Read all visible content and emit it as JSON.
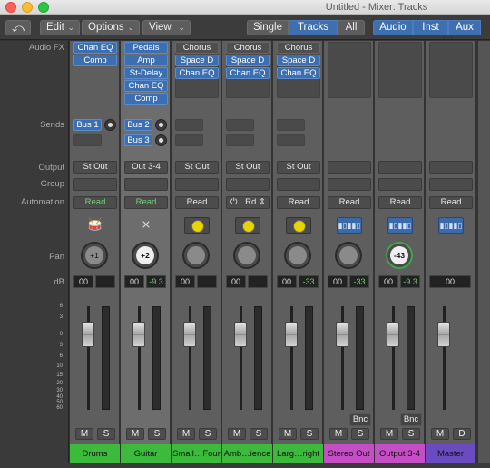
{
  "window": {
    "title": "Untitled - Mixer: Tracks"
  },
  "toolbar": {
    "edit_label": "Edit",
    "options_label": "Options",
    "view_label": "View",
    "single_label": "Single",
    "tracks_label": "Tracks",
    "all_label": "All",
    "audio_label": "Audio",
    "inst_label": "Inst",
    "aux_label": "Aux"
  },
  "row_labels": {
    "audio_fx": "Audio FX",
    "sends": "Sends",
    "output": "Output",
    "group": "Group",
    "automation": "Automation",
    "pan": "Pan",
    "db": "dB"
  },
  "scale_marks": [
    "6",
    "3",
    "0",
    "3",
    "6",
    "10",
    "15",
    "20",
    "30",
    "40",
    "50",
    "60"
  ],
  "strips": [
    {
      "name": "Drums",
      "plugins": [
        "Chan EQ",
        "Comp"
      ],
      "sends": [
        "Bus 1"
      ],
      "output": "St Out",
      "automation": "Read",
      "pan": "+1",
      "db_left": "00",
      "db_right": "",
      "mute": "M",
      "solo": "S"
    },
    {
      "name": "Guitar",
      "plugins": [
        "Pedals",
        "Amp",
        "St-Delay",
        "Chan EQ",
        "Comp"
      ],
      "sends": [
        "Bus 2",
        "Bus 3"
      ],
      "output": "Out 3-4",
      "automation": "Read",
      "pan": "+2",
      "db_left": "00",
      "db_right": "-9.3",
      "mute": "M",
      "solo": "S"
    },
    {
      "name": "Small…Four",
      "plugins": [
        "Chorus",
        "Space D",
        "Chan EQ"
      ],
      "sends": [],
      "output": "St Out",
      "automation": "Read",
      "pan": "",
      "db_left": "00",
      "db_right": "",
      "mute": "M",
      "solo": "S"
    },
    {
      "name": "Amb…ience",
      "plugins": [
        "Chorus",
        "Space D",
        "Chan EQ"
      ],
      "sends": [],
      "output": "St Out",
      "automation": "Rd",
      "pan": "",
      "db_left": "00",
      "db_right": "",
      "mute": "M",
      "solo": "S"
    },
    {
      "name": "Larg…right",
      "plugins": [
        "Chorus",
        "Space D",
        "Chan EQ"
      ],
      "sends": [],
      "output": "St Out",
      "automation": "Read",
      "pan": "",
      "db_left": "00",
      "db_right": "-33",
      "mute": "M",
      "solo": "S"
    },
    {
      "name": "Stereo Out",
      "plugins": [],
      "sends": [],
      "output": "",
      "automation": "Read",
      "pan": "",
      "db_left": "00",
      "db_right": "-33",
      "bounce": "Bnc",
      "mute": "M",
      "solo": "S"
    },
    {
      "name": "Output 3-4",
      "plugins": [],
      "sends": [],
      "output": "",
      "automation": "Read",
      "pan": "-43",
      "db_left": "00",
      "db_right": "-9.3",
      "bounce": "Bnc",
      "mute": "M",
      "solo": "S"
    },
    {
      "name": "Master",
      "plugins": [],
      "sends": [],
      "output": "",
      "automation": "Read",
      "pan": "",
      "db_left": "00",
      "db_right": "",
      "mute": "M",
      "solo": "D"
    }
  ],
  "colors": {
    "plugin_blue": "#3c6fb2",
    "track_green": "#3cba3c",
    "output_magenta": "#c54ec5",
    "master_purple": "#6a4bc0",
    "automation_green": "#6fd36f"
  }
}
